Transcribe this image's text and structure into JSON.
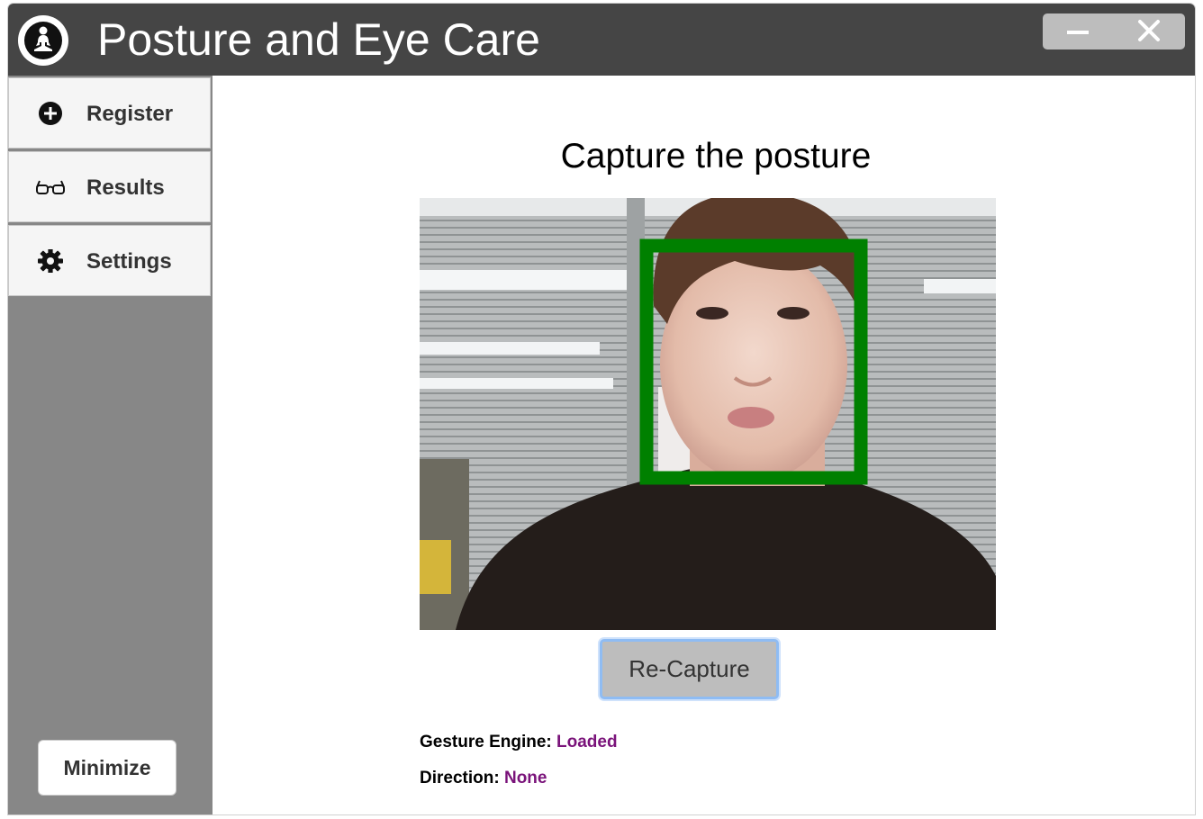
{
  "app": {
    "title": "Posture and Eye Care",
    "logo_icon": "meditation-figure-icon"
  },
  "window_controls": {
    "minimize_icon": "minus-icon",
    "close_icon": "close-icon"
  },
  "sidebar": {
    "items": [
      {
        "label": "Register",
        "icon": "plus-circle-icon"
      },
      {
        "label": "Results",
        "icon": "glasses-icon"
      },
      {
        "label": "Settings",
        "icon": "gear-icon"
      }
    ],
    "minimize_label": "Minimize"
  },
  "main": {
    "heading": "Capture the posture",
    "recapture_label": "Re-Capture",
    "status": {
      "engine_label": "Gesture Engine:",
      "engine_value": "Loaded",
      "direction_label": "Direction:",
      "direction_value": "None"
    }
  },
  "colors": {
    "titlebar": "#454545",
    "sidebar": "#878787",
    "face_box": "#008000",
    "status_value": "#7a137a",
    "button_focus": "#8fbcf3"
  }
}
